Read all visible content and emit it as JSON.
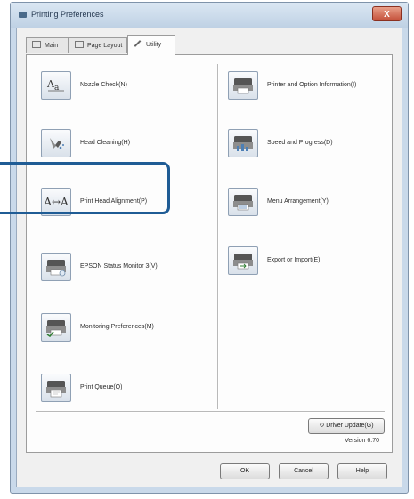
{
  "window": {
    "title": "Printing Preferences",
    "close_label": "X"
  },
  "tabs": [
    {
      "label": "Main"
    },
    {
      "label": "Page Layout"
    },
    {
      "label": "Utility"
    }
  ],
  "left_items": [
    {
      "label": "Nozzle Check(N)",
      "icon": "nozzle-check-icon"
    },
    {
      "label": "Head Cleaning(H)",
      "icon": "head-cleaning-icon"
    },
    {
      "label": "Print Head Alignment(P)",
      "icon": "print-head-alignment-icon",
      "icon_text": "A↔A"
    },
    {
      "label": "EPSON Status Monitor 3(V)",
      "icon": "status-monitor-icon"
    },
    {
      "label": "Monitoring Preferences(M)",
      "icon": "monitoring-preferences-icon"
    },
    {
      "label": "Print Queue(Q)",
      "icon": "print-queue-icon"
    }
  ],
  "right_items": [
    {
      "label": "Printer and Option Information(I)",
      "icon": "printer-information-icon"
    },
    {
      "label": "Speed and Progress(D)",
      "icon": "speed-progress-icon"
    },
    {
      "label": "Menu Arrangement(Y)",
      "icon": "menu-arrangement-icon"
    },
    {
      "label": "Export or Import(E)",
      "icon": "export-import-icon"
    }
  ],
  "driver_update_label": "↻ Driver Update(G)",
  "version": "Version 6.70",
  "buttons": {
    "ok": "OK",
    "cancel": "Cancel",
    "help": "Help"
  },
  "colors": {
    "highlight": "#1f5c95",
    "titlebar": "#c9d9ea",
    "close": "#c4503a"
  }
}
